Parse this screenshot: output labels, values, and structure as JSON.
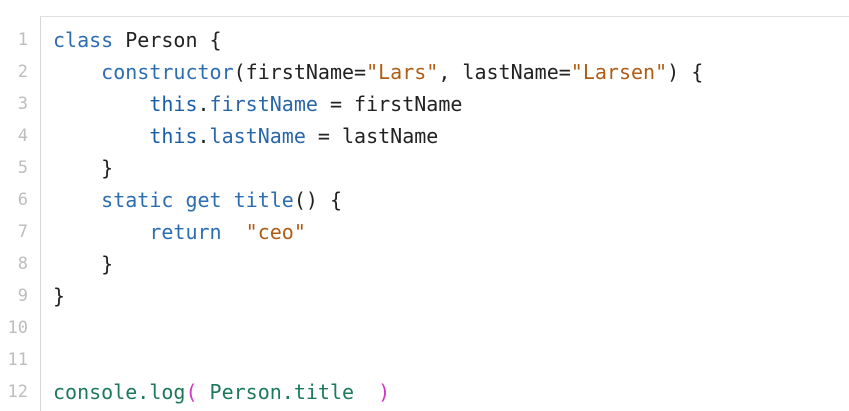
{
  "editor": {
    "line_numbers": [
      "1",
      "2",
      "3",
      "4",
      "5",
      "6",
      "7",
      "8",
      "9",
      "10",
      "11",
      "12"
    ],
    "line1": {
      "kw": "class",
      "name": " Person {"
    },
    "line2": {
      "indent": "    ",
      "kw": "constructor",
      "p1": "(firstName=",
      "s1": "\"Lars\"",
      "p2": ", lastName=",
      "s2": "\"Larsen\"",
      "p3": ") {"
    },
    "line3": {
      "indent": "        ",
      "kw": "this",
      "dot": ".",
      "prop": "firstName",
      "rest": " = firstName"
    },
    "line4": {
      "indent": "        ",
      "kw": "this",
      "dot": ".",
      "prop": "lastName",
      "rest": " = lastName"
    },
    "line5": {
      "text": "    }"
    },
    "line6": {
      "indent": "    ",
      "kw1": "static",
      "sp1": " ",
      "kw2": "get",
      "sp2": " ",
      "fn": "title",
      "rest": "() {"
    },
    "line7": {
      "indent": "        ",
      "kw": "return",
      "sp": "  ",
      "str": "\"ceo\""
    },
    "line8": {
      "text": "    }"
    },
    "line9": {
      "text": "}"
    },
    "line12": {
      "obj": "console",
      "dot": ".",
      "fn": "log",
      "open": "(",
      "arg": " Person.title  ",
      "close": ")"
    }
  }
}
